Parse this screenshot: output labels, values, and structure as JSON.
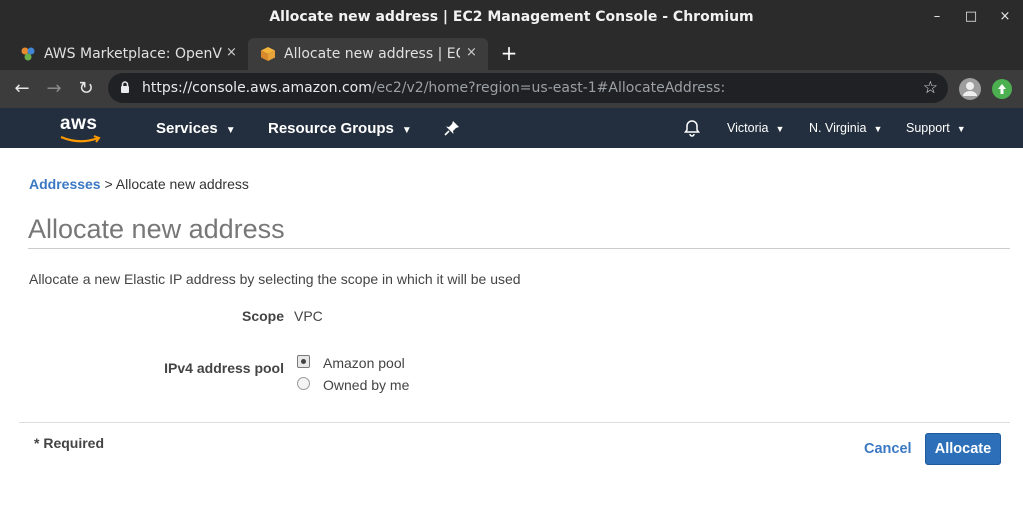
{
  "window": {
    "title": "Allocate new address | EC2 Management Console - Chromium",
    "minimize": "–",
    "maximize": "□",
    "close": "×"
  },
  "tabs": [
    {
      "label": "AWS Marketplace: OpenV",
      "close": "×",
      "icon": "aws-marketplace-icon"
    },
    {
      "label": "Allocate new address | EC",
      "close": "×",
      "icon": "aws-box-icon",
      "active": true
    }
  ],
  "new_tab": "+",
  "toolbar": {
    "back": "←",
    "forward": "→",
    "reload": "↻",
    "url_host": "https://console.aws.amazon.com",
    "url_path": "/ec2/v2/home?region=us-east-1#AllocateAddress:",
    "star": "☆"
  },
  "aws_nav": {
    "logo": "aws",
    "services": "Services",
    "resource_groups": "Resource Groups",
    "user": "Victoria",
    "region": "N. Virginia",
    "support": "Support"
  },
  "breadcrumb": {
    "parent": "Addresses",
    "separator": ">",
    "current": "Allocate new address"
  },
  "page": {
    "title": "Allocate new address",
    "description": "Allocate a new Elastic IP address by selecting the scope in which it will be used"
  },
  "form": {
    "scope_label": "Scope",
    "scope_value": "VPC",
    "pool_label": "IPv4 address pool",
    "options": [
      {
        "label": "Amazon pool",
        "checked": true
      },
      {
        "label": "Owned by me",
        "checked": false
      }
    ]
  },
  "footer": {
    "required": "* Required",
    "cancel": "Cancel",
    "allocate": "Allocate"
  },
  "colors": {
    "link": "#3b78c4",
    "primary_button": "#2d6fb8",
    "aws_nav_bg": "#232f3e",
    "aws_orange": "#ff9900"
  }
}
